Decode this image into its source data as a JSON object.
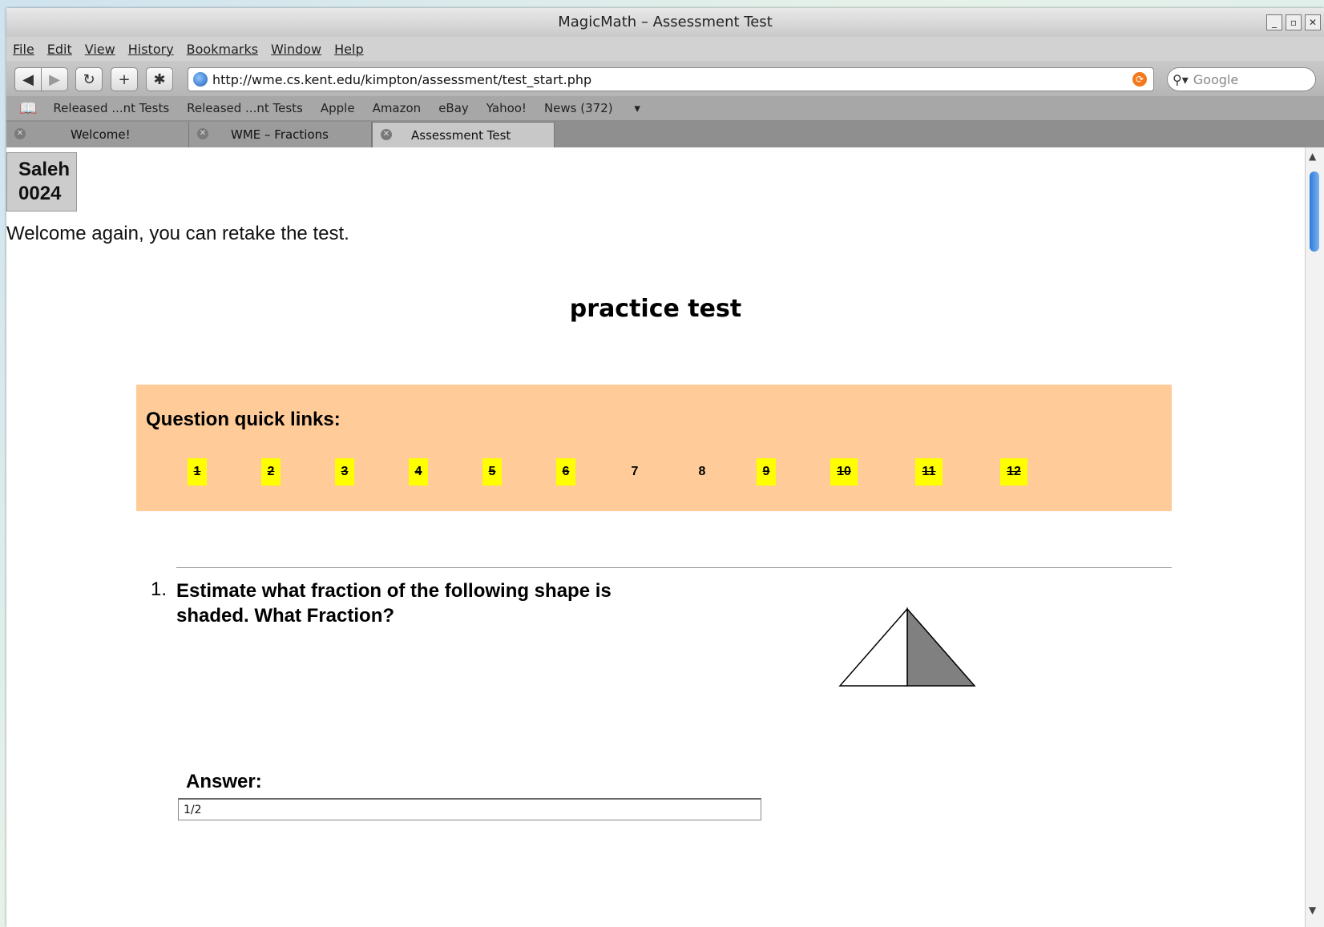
{
  "window": {
    "title": "MagicMath – Assessment Test"
  },
  "menu": [
    "File",
    "Edit",
    "View",
    "History",
    "Bookmarks",
    "Window",
    "Help"
  ],
  "nav": {
    "url": "http://wme.cs.kent.edu/kimpton/assessment/test_start.php",
    "search_placeholder": "Google"
  },
  "bookmarks": [
    "Released ...nt Tests",
    "Released ...nt Tests",
    "Apple",
    "Amazon",
    "eBay",
    "Yahoo!",
    "News (372)"
  ],
  "tabs": [
    {
      "label": "Welcome!"
    },
    {
      "label": "WME – Fractions"
    },
    {
      "label": "Assessment Test"
    }
  ],
  "user": {
    "name": "Saleh",
    "id": "0024"
  },
  "welcome_text": "Welcome again, you can retake the test.",
  "page_title": "practice test",
  "quick_links": {
    "heading": "Question quick links:",
    "links": [
      "1",
      "2",
      "3",
      "4",
      "5",
      "6",
      "7",
      "8",
      "9",
      "10",
      "11",
      "12"
    ],
    "answered": [
      true,
      true,
      true,
      true,
      true,
      true,
      false,
      false,
      true,
      true,
      true,
      true
    ]
  },
  "question": {
    "number": "1.",
    "text": "Estimate what fraction of the following shape is shaded. What Fraction?",
    "shaded_fraction_shown": 0.5
  },
  "answer": {
    "label": "Answer:",
    "value": "1/2"
  },
  "colors": {
    "quick_links_bg": "#ffcc99",
    "answered_highlight": "#ffff00",
    "shade": "#808080"
  }
}
